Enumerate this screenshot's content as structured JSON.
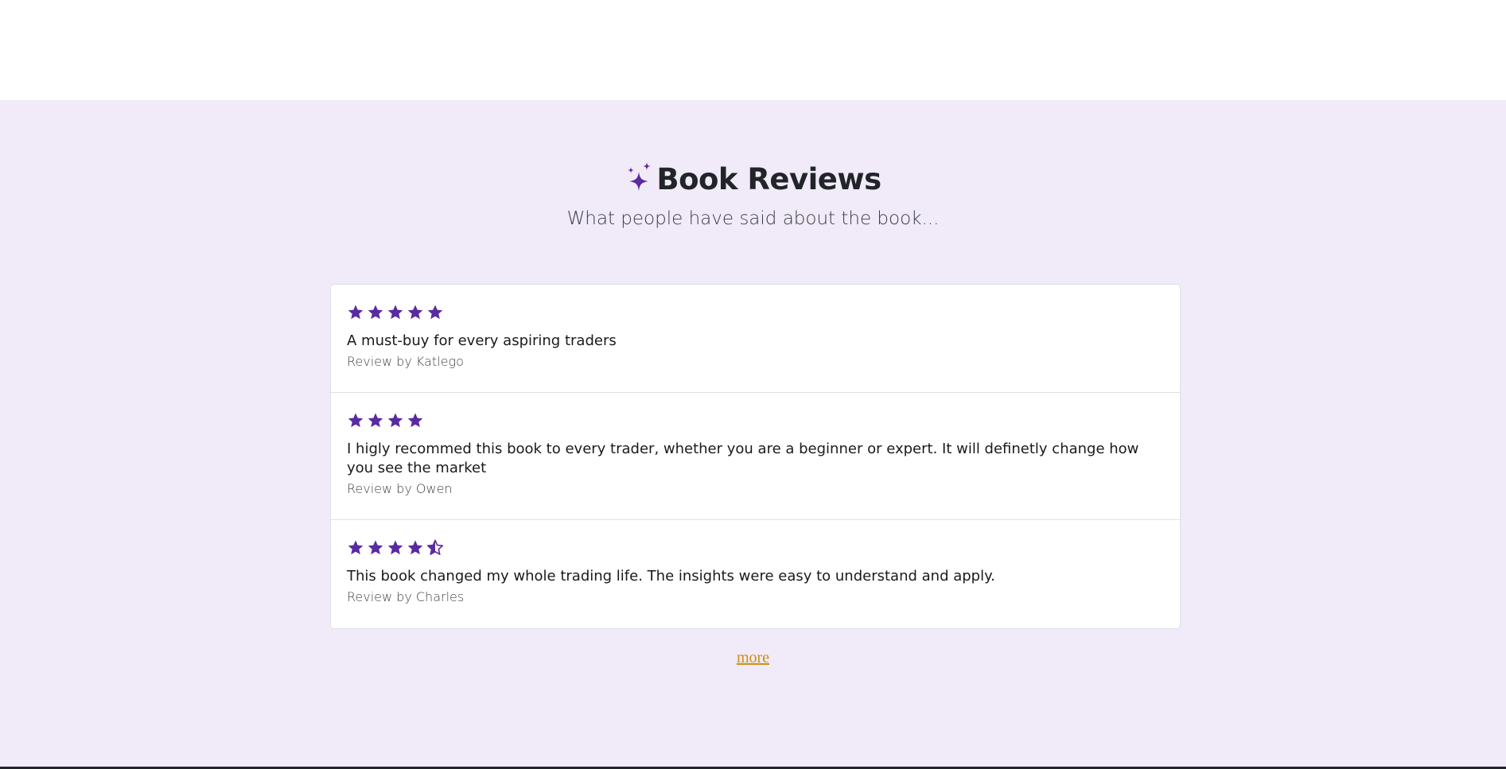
{
  "section": {
    "title": "Book Reviews",
    "subtitle": "What people have said about the book...",
    "title_icon": "sparkles-icon",
    "accent_color": "#5a2aa0",
    "background_color": "#f1eaf8"
  },
  "reviews": [
    {
      "rating": 5,
      "text": "A must-buy for every aspiring traders",
      "author": "Review by Katlego"
    },
    {
      "rating": 4,
      "text": "I higly recommed this book to every trader, whether you are a beginner or expert. It will definetly change how you see the market",
      "author": "Review by Owen"
    },
    {
      "rating": 4.5,
      "text": "This book changed my whole trading life. The insights were easy to understand and apply.",
      "author": "Review by Charles"
    }
  ],
  "more_link": {
    "label": "more",
    "color": "#c9920f"
  }
}
